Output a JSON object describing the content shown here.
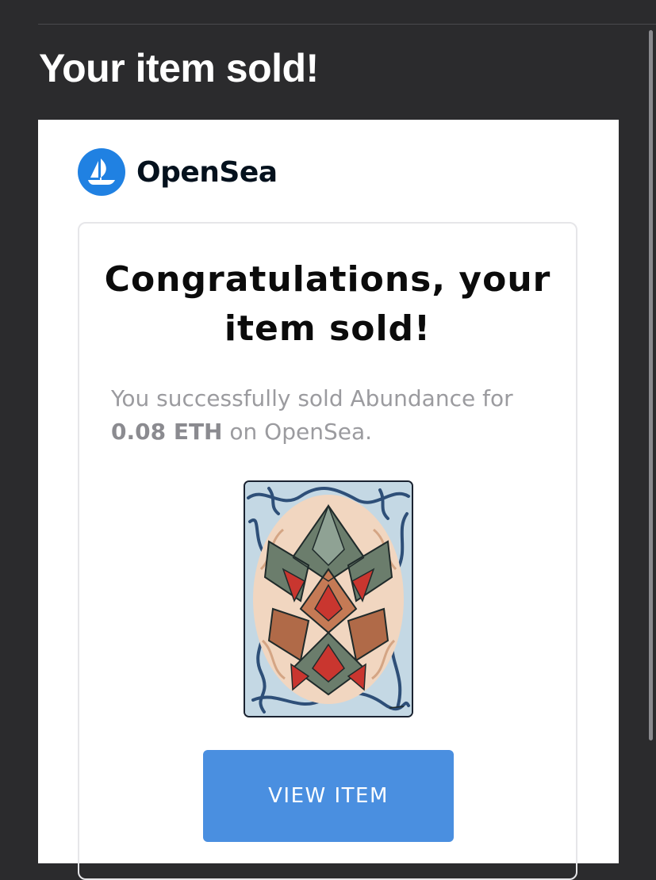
{
  "email": {
    "subject": "Your item sold!"
  },
  "brand": {
    "name": "OpenSea",
    "logo_icon": "opensea-ship-icon",
    "color": "#2081e2"
  },
  "notification": {
    "headline": "Congratulations, your item sold!",
    "message_prefix": "You successfully sold Abundance for",
    "price": "0.08 ETH",
    "message_suffix": "on OpenSea.",
    "item_image": "abstract-artwork-abundance"
  },
  "actions": {
    "view_item_label": "VIEW ITEM",
    "button_color": "#4a8fe0"
  }
}
